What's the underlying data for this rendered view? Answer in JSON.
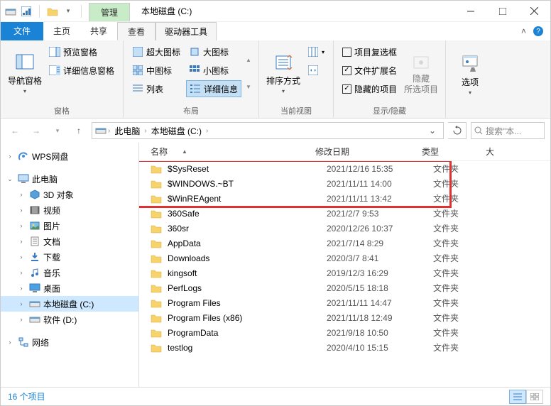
{
  "title": "本地磁盘 (C:)",
  "contextTab": "管理",
  "contextSub": "驱动器工具",
  "menuTabs": {
    "file": "文件",
    "home": "主页",
    "share": "共享",
    "view": "查看"
  },
  "ribbon": {
    "pane": {
      "navPane": "导航窗格",
      "preview": "预览窗格",
      "details": "详细信息窗格",
      "label": "窗格"
    },
    "layout": {
      "r1a": "超大图标",
      "r1b": "大图标",
      "r2a": "中图标",
      "r2b": "小图标",
      "r3a": "列表",
      "r3b": "详细信息",
      "label": "布局"
    },
    "currentView": {
      "sort": "排序方式",
      "label": "当前视图"
    },
    "showHide": {
      "itemCheck": "项目复选框",
      "ext": "文件扩展名",
      "hidden": "隐藏的项目",
      "hideSel": "隐藏\n所选项目",
      "label": "显示/隐藏"
    },
    "options": "选项"
  },
  "path": {
    "thisPC": "此电脑",
    "drive": "本地磁盘 (C:)"
  },
  "searchPlaceholder": "搜索\"本...",
  "columns": {
    "name": "名称",
    "date": "修改日期",
    "type": "类型",
    "size": "大"
  },
  "nav": {
    "wps": "WPS网盘",
    "thisPC": "此电脑",
    "obj3d": "3D 对象",
    "videos": "视频",
    "pictures": "图片",
    "documents": "文档",
    "downloads": "下载",
    "music": "音乐",
    "desktop": "桌面",
    "driveC": "本地磁盘 (C:)",
    "driveD": "软件 (D:)",
    "network": "网络"
  },
  "files": [
    {
      "name": "$SysReset",
      "date": "2021/12/16 15:35",
      "type": "文件夹"
    },
    {
      "name": "$WINDOWS.~BT",
      "date": "2021/11/11 14:00",
      "type": "文件夹"
    },
    {
      "name": "$WinREAgent",
      "date": "2021/11/11 13:42",
      "type": "文件夹"
    },
    {
      "name": "360Safe",
      "date": "2021/2/7 9:53",
      "type": "文件夹"
    },
    {
      "name": "360sr",
      "date": "2020/12/26 10:37",
      "type": "文件夹"
    },
    {
      "name": "AppData",
      "date": "2021/7/14 8:29",
      "type": "文件夹"
    },
    {
      "name": "Downloads",
      "date": "2020/3/7 8:41",
      "type": "文件夹"
    },
    {
      "name": "kingsoft",
      "date": "2019/12/3 16:29",
      "type": "文件夹"
    },
    {
      "name": "PerfLogs",
      "date": "2020/5/15 18:18",
      "type": "文件夹"
    },
    {
      "name": "Program Files",
      "date": "2021/11/11 14:47",
      "type": "文件夹"
    },
    {
      "name": "Program Files (x86)",
      "date": "2021/11/18 12:49",
      "type": "文件夹"
    },
    {
      "name": "ProgramData",
      "date": "2021/9/18 10:50",
      "type": "文件夹"
    },
    {
      "name": "testlog",
      "date": "2020/4/10 15:15",
      "type": "文件夹"
    }
  ],
  "status": "16 个项目"
}
